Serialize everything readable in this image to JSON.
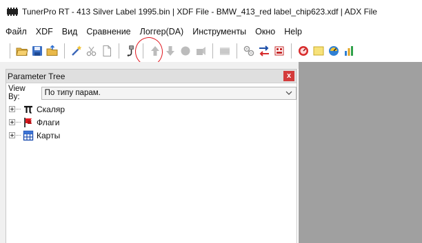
{
  "window": {
    "title": "TunerPro RT - 413 Silver Label 1995.bin | XDF File - BMW_413_red label_chip623.xdf | ADX File"
  },
  "menu": [
    "Файл",
    "XDF",
    "Вид",
    "Сравнение",
    "Логгер(DA)",
    "Инструменты",
    "Окно",
    "Help"
  ],
  "toolbar": {
    "icons": [
      "open-icon",
      "save-icon",
      "open-bin-icon",
      "wand-icon",
      "cut-icon",
      "new-icon",
      "probe-icon",
      "arrow-up-icon",
      "arrow-down-icon",
      "record-icon",
      "stop-icon",
      "chip-icon",
      "emulator-icon",
      "compare-icon",
      "flash-icon",
      "logger-icon",
      "note-icon",
      "monitor-icon",
      "chart-icon"
    ],
    "highlighted": "probe-icon"
  },
  "panel": {
    "title": "Parameter Tree",
    "close_label": "x",
    "viewby_label": "View By:",
    "viewby_value": "По типу парам.",
    "tree": [
      {
        "label": "Скаляр",
        "icon": "pi-icon"
      },
      {
        "label": "Флаги",
        "icon": "flag-icon"
      },
      {
        "label": "Карты",
        "icon": "table-icon"
      }
    ]
  },
  "colors": {
    "workspace": "#a0a0a0",
    "panel_header": "#dfdfdf",
    "close_button": "#d43b3b",
    "highlight": "#e0141c"
  }
}
